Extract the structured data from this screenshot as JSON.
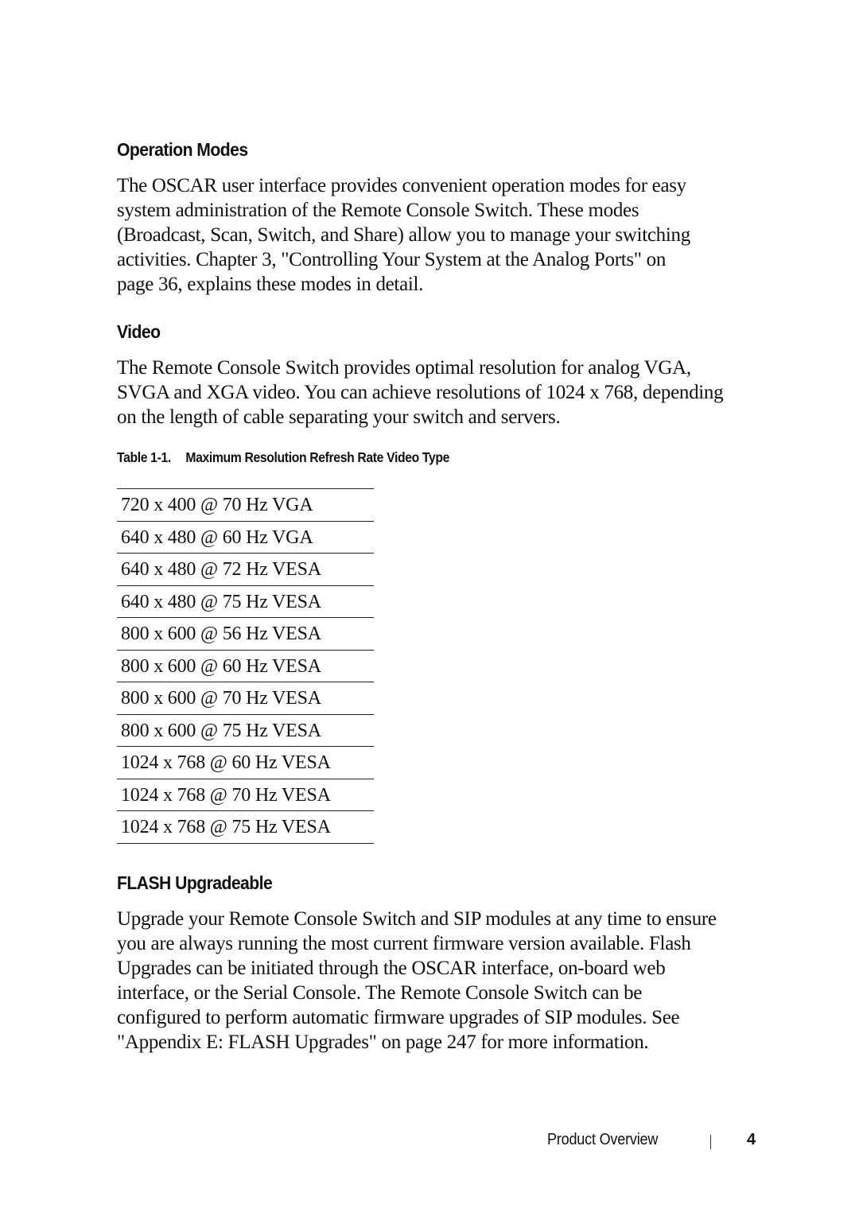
{
  "sections": {
    "operation_modes": {
      "heading": "Operation Modes",
      "lines": [
        "The OSCAR user interface provides convenient operation modes for easy",
        "system administration of the Remote Console Switch. These modes",
        "(Broadcast, Scan, Switch, and Share) allow you to manage your switching",
        "activities. Chapter 3, \"Controlling Your System at the Analog Ports\" on",
        "page 36, explains these modes in detail."
      ]
    },
    "video": {
      "heading": "Video",
      "lines": [
        "The Remote Console Switch provides optimal resolution for analog VGA,",
        "SVGA and XGA video. You can achieve resolutions of 1024 x 768, depending",
        "on the length of cable separating your switch and servers."
      ]
    },
    "table": {
      "caption_number": "Table 1-1.",
      "caption_title": "Maximum Resolution Refresh Rate Video Type",
      "rows": [
        "720 x 400 @ 70 Hz VGA",
        "640 x 480 @ 60 Hz VGA",
        "640 x 480 @ 72 Hz VESA",
        "640 x 480 @ 75 Hz VESA",
        "800 x 600 @ 56 Hz VESA",
        "800 x 600 @ 60 Hz VESA",
        "800 x 600 @ 70 Hz VESA",
        "800 x 600 @ 75 Hz VESA",
        "1024 x 768 @ 60 Hz VESA",
        "1024 x 768 @ 70 Hz VESA",
        "1024 x 768 @ 75 Hz VESA"
      ]
    },
    "flash": {
      "heading": "FLASH Upgradeable",
      "lines": [
        "Upgrade your Remote Console Switch and SIP modules at any time to ensure",
        "you are always running the most current firmware version available. Flash",
        "Upgrades can be initiated through the OSCAR interface, on-board web",
        "interface, or the Serial Console. The Remote Console Switch can be",
        "configured to perform automatic firmware upgrades of SIP modules. See",
        "\"Appendix E: FLASH Upgrades\" on page 247 for more information."
      ]
    }
  },
  "footer": {
    "section_name": "Product Overview",
    "page_number": "4"
  }
}
